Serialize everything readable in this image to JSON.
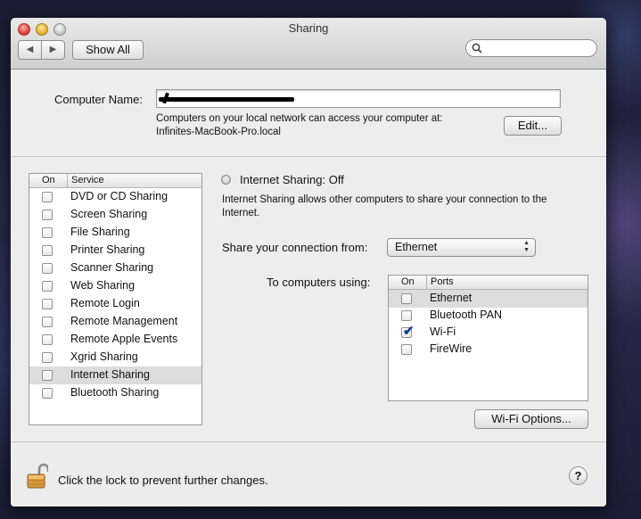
{
  "window": {
    "title": "Sharing",
    "show_all_label": "Show All",
    "search_placeholder": ""
  },
  "computer_name": {
    "label": "Computer Name:",
    "value": "",
    "info_line1": "Computers on your local network can access your computer at:",
    "info_line2": "Infinites-MacBook-Pro.local",
    "edit_label": "Edit..."
  },
  "services": {
    "header_on": "On",
    "header_service": "Service",
    "items": [
      {
        "label": "DVD or CD Sharing",
        "on": false,
        "selected": false
      },
      {
        "label": "Screen Sharing",
        "on": false,
        "selected": false
      },
      {
        "label": "File Sharing",
        "on": false,
        "selected": false
      },
      {
        "label": "Printer Sharing",
        "on": false,
        "selected": false
      },
      {
        "label": "Scanner Sharing",
        "on": false,
        "selected": false
      },
      {
        "label": "Web Sharing",
        "on": false,
        "selected": false
      },
      {
        "label": "Remote Login",
        "on": false,
        "selected": false
      },
      {
        "label": "Remote Management",
        "on": false,
        "selected": false
      },
      {
        "label": "Remote Apple Events",
        "on": false,
        "selected": false
      },
      {
        "label": "Xgrid Sharing",
        "on": false,
        "selected": false
      },
      {
        "label": "Internet Sharing",
        "on": false,
        "selected": true
      },
      {
        "label": "Bluetooth Sharing",
        "on": false,
        "selected": false
      }
    ]
  },
  "detail": {
    "status": "Internet Sharing: Off",
    "description_line1": "Internet Sharing allows other computers to share your connection to the",
    "description_line2": "Internet.",
    "share_from_label": "Share your connection from:",
    "share_from_value": "Ethernet",
    "to_computers_label": "To computers using:",
    "ports_header_on": "On",
    "ports_header_ports": "Ports",
    "ports": [
      {
        "label": "Ethernet",
        "on": false,
        "selected": true
      },
      {
        "label": "Bluetooth PAN",
        "on": false,
        "selected": false
      },
      {
        "label": "Wi-Fi",
        "on": true,
        "selected": false
      },
      {
        "label": "FireWire",
        "on": false,
        "selected": false
      }
    ],
    "wifi_options_label": "Wi-Fi Options..."
  },
  "footer": {
    "lock_text": "Click the lock to prevent further changes.",
    "help_label": "?"
  },
  "colors": {
    "check_mark": "#1b3e8a",
    "selected_row": "#dcdcdc"
  }
}
